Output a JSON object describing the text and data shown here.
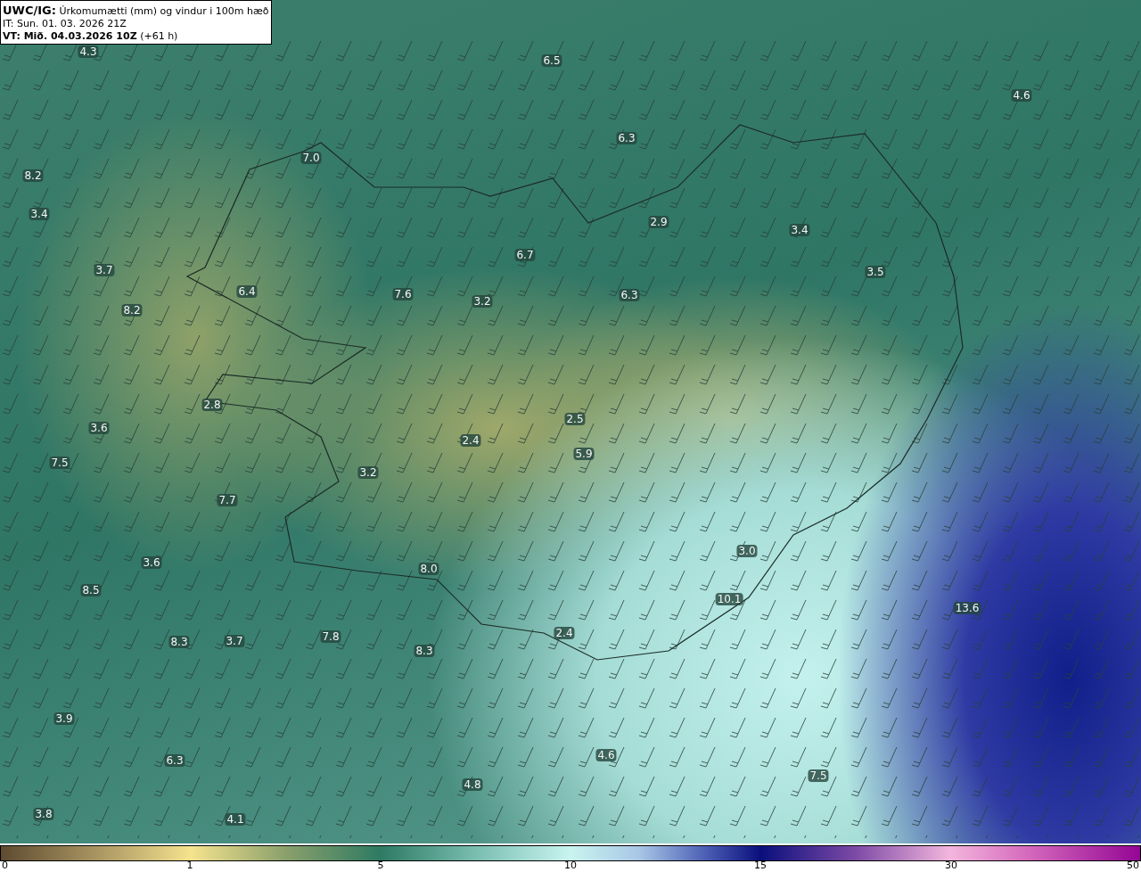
{
  "header": {
    "model": "UWC/IG:",
    "title": "Úrkomumætti (mm) og vindur i 100m hæð",
    "init_time": "IT: Sun. 01. 03. 2026 21Z",
    "valid_time": "VT: Mið. 04.03.2026 10Z",
    "lead": "(+61 h)"
  },
  "map": {
    "value_labels": [
      "4.3",
      "6.5",
      "4.6",
      "6.3",
      "7.0",
      "8.2",
      "3.4",
      "2.9",
      "3.4",
      "6.7",
      "3.7",
      "3.5",
      "6.4",
      "7.6",
      "3.2",
      "6.3",
      "8.2",
      "2.8",
      "2.5",
      "3.6",
      "2.4",
      "5.9",
      "7.5",
      "3.2",
      "7.7",
      "3.6",
      "8.0",
      "3.0",
      "8.5",
      "10.1",
      "13.6",
      "8.3",
      "3.7",
      "7.8",
      "8.3",
      "2.4",
      "3.9",
      "4.6",
      "6.3",
      "4.8",
      "7.5",
      "3.8",
      "4.1"
    ]
  },
  "colorbar": {
    "ticks": [
      "0",
      "1",
      "5",
      "10",
      "15",
      "30",
      "50"
    ]
  }
}
